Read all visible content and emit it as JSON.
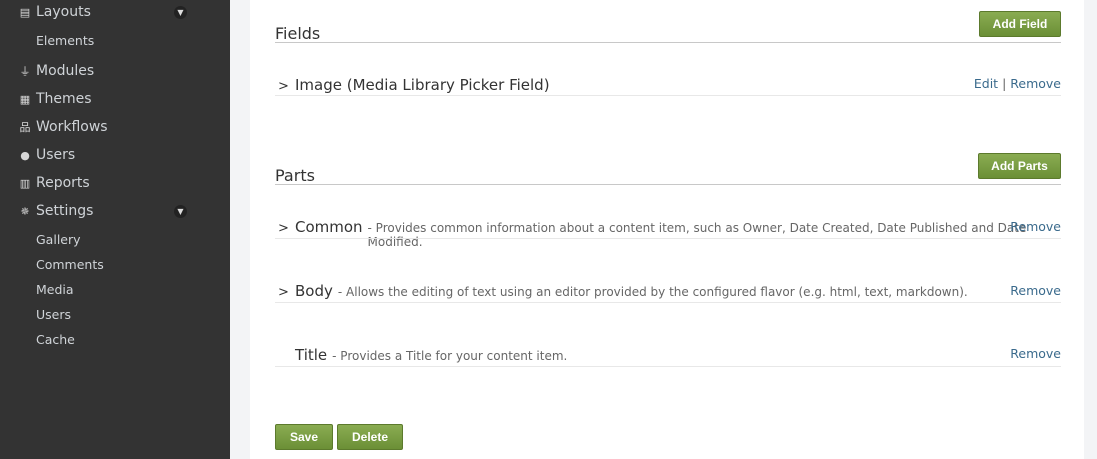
{
  "sidebar": {
    "layouts": {
      "label": "Layouts",
      "icon": "layout-icon"
    },
    "elements": "Elements",
    "modules": {
      "label": "Modules",
      "icon": "plug-icon"
    },
    "themes": {
      "label": "Themes",
      "icon": "theme-icon"
    },
    "workflows": {
      "label": "Workflows",
      "icon": "sitemap-icon"
    },
    "users": {
      "label": "Users",
      "icon": "user-icon"
    },
    "reports": {
      "label": "Reports",
      "icon": "bar-chart-icon"
    },
    "settings": {
      "label": "Settings",
      "icon": "gear-icon"
    },
    "settings_items": [
      "Gallery",
      "Comments",
      "Media",
      "Users",
      "Cache"
    ]
  },
  "fields": {
    "title": "Fields",
    "add_label": "Add Field",
    "items": [
      {
        "name": "Image (Media Library Picker Field)",
        "edit": "Edit",
        "sep": "|",
        "remove": "Remove"
      }
    ]
  },
  "parts": {
    "title": "Parts",
    "add_label": "Add Parts",
    "items": [
      {
        "name": "Common",
        "desc": "- Provides common information about a content item, such as Owner, Date Created, Date Published and Date Modified.",
        "remove": "Remove"
      },
      {
        "name": "Body",
        "desc": "- Allows the editing of text using an editor provided by the configured flavor (e.g. html, text, markdown).",
        "remove": "Remove"
      },
      {
        "name": "Title",
        "desc": "- Provides a Title for your content item.",
        "remove": "Remove"
      }
    ]
  },
  "actions": {
    "save": "Save",
    "delete": "Delete"
  },
  "colors": {
    "sidebar": "#333333",
    "button": "#7a9c45",
    "link": "#3a6a8c"
  }
}
